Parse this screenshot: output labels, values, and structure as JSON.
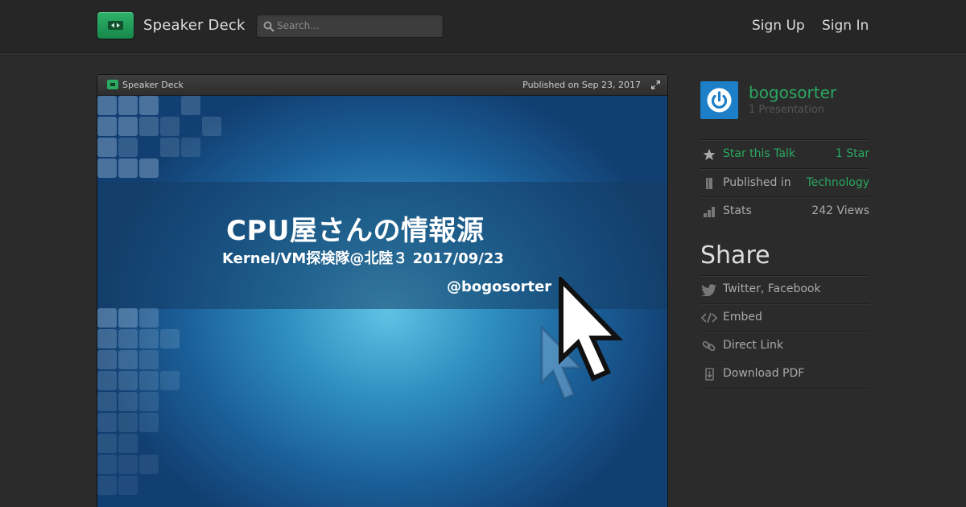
{
  "header": {
    "brand": "Speaker Deck",
    "search_placeholder": "Search...",
    "sign_up": "Sign Up",
    "sign_in": "Sign In"
  },
  "player": {
    "brand": "Speaker Deck",
    "published": "Published on Sep 23, 2017",
    "slide": {
      "title": "CPU屋さんの情報源",
      "subtitle": "Kernel/VM探検隊@北陸３ 2017/09/23",
      "author": "@bogosorter"
    }
  },
  "sidebar": {
    "author": {
      "name": "bogosorter",
      "presentations": "1 Presentation"
    },
    "stats": [
      {
        "label": "Star this Talk",
        "value": "1 Star",
        "icon": "star-icon"
      },
      {
        "label": "Published in",
        "value": "Technology",
        "icon": "bookmark-icon"
      },
      {
        "label": "Stats",
        "value": "242 Views",
        "icon": "bar-chart-icon"
      }
    ],
    "share_title": "Share",
    "share": [
      {
        "label": "Twitter, Facebook",
        "icon": "bird-icon"
      },
      {
        "label": "Embed",
        "icon": "code-icon"
      },
      {
        "label": "Direct Link",
        "icon": "link-icon"
      },
      {
        "label": "Download PDF",
        "icon": "download-icon"
      }
    ]
  },
  "colors": {
    "accent": "#2aa860",
    "background": "#2b2b2b",
    "avatar": "#1d7fc7"
  }
}
